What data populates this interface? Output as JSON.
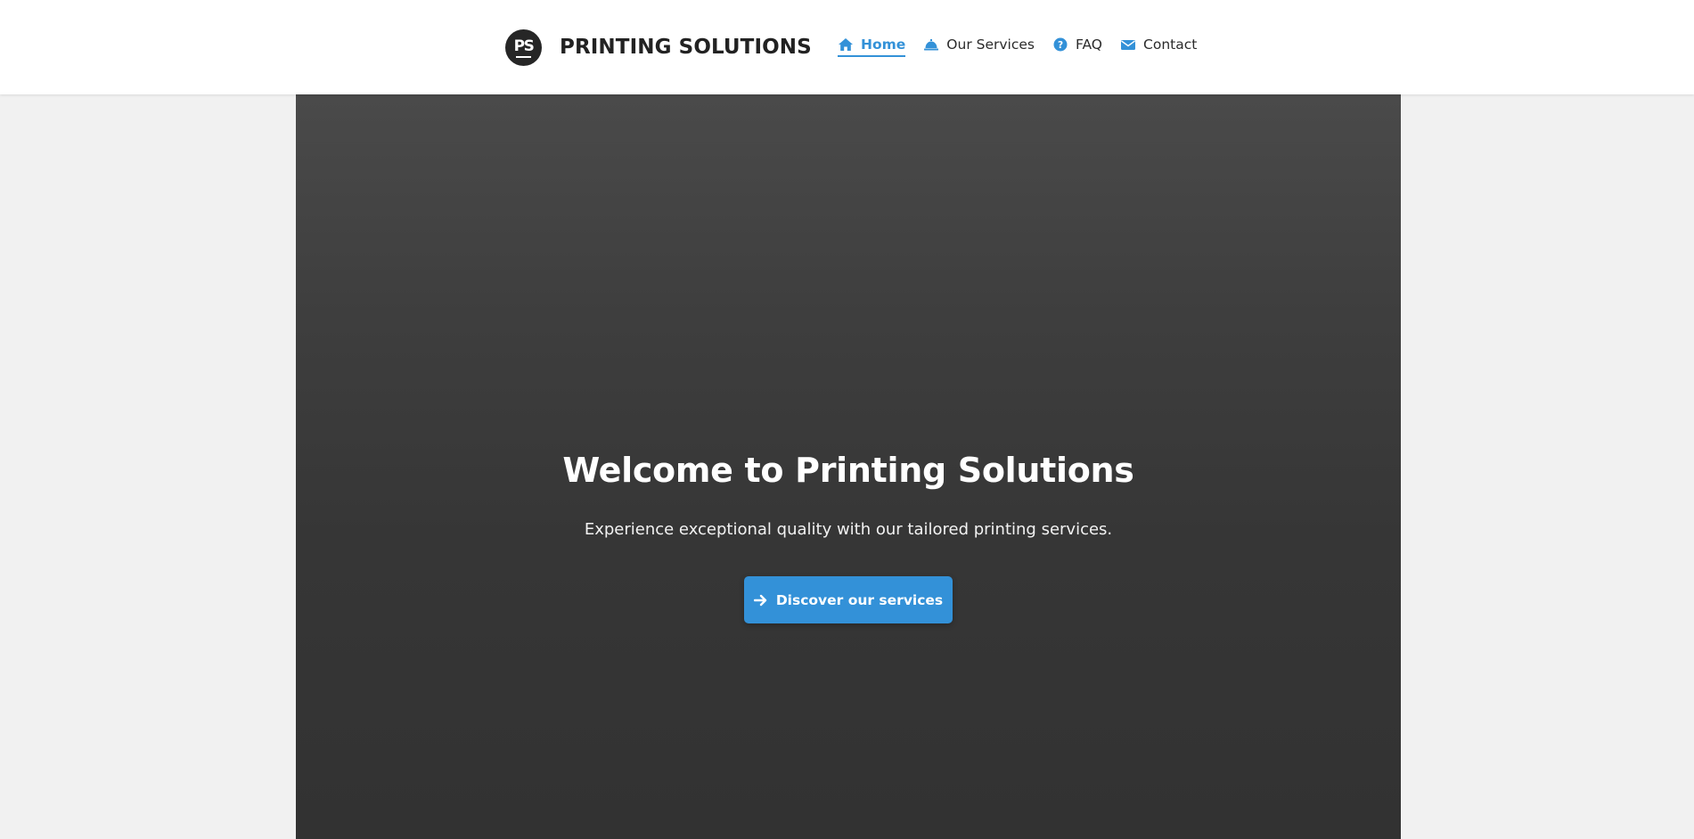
{
  "header": {
    "brand": {
      "logo_text": "PS",
      "name": "PRINTING SOLUTIONS"
    },
    "nav": [
      {
        "label": "Home",
        "icon": "home-icon",
        "active": true
      },
      {
        "label": "Our Services",
        "icon": "bell-icon",
        "active": false
      },
      {
        "label": "FAQ",
        "icon": "question-circle-icon",
        "active": false
      },
      {
        "label": "Contact",
        "icon": "envelope-icon",
        "active": false
      }
    ]
  },
  "hero": {
    "title": "Welcome to Printing Solutions",
    "subtitle": "Experience exceptional quality with our tailored printing services.",
    "cta_label": "Discover our services",
    "cta_icon": "arrow-right-icon"
  },
  "colors": {
    "accent": "#3391d8",
    "header_bg": "#ffffff",
    "page_bg": "#f1f1f1",
    "hero_bg": "#3a3a3a",
    "logo_bg": "#262626"
  }
}
